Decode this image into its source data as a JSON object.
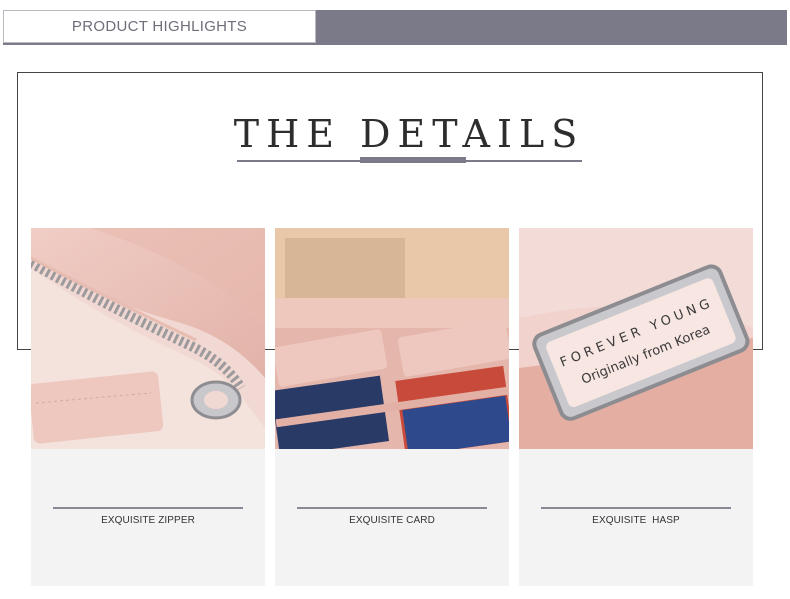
{
  "header": {
    "tab_label": "PRODUCT HIGHLIGHTS"
  },
  "details": {
    "title": "THE DETAILS"
  },
  "cards": [
    {
      "caption": "EXQUISITE ZIPPER",
      "image_label": "zipper"
    },
    {
      "caption": "EXQUISITE CARD",
      "image_label": "card-slots"
    },
    {
      "caption": "EXQUISITE  HASP",
      "image_label": "metal-hasp",
      "plate_line_1": "FOREVER YOUNG",
      "plate_line_2": "Originally from Korea"
    }
  ],
  "colors": {
    "accent": "#7b7a88",
    "card_bg": "#f3f3f4",
    "leather_pink": "#e9c3bb"
  }
}
